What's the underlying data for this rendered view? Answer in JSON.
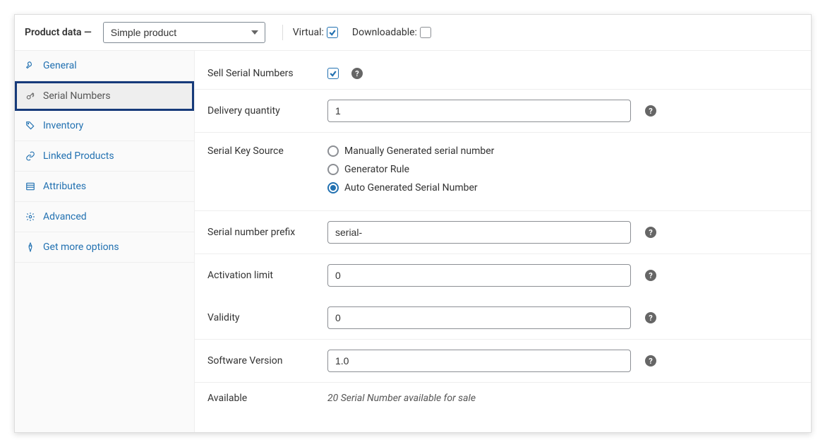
{
  "header": {
    "title": "Product data —",
    "product_type": "Simple product",
    "virtual_label": "Virtual:",
    "virtual_checked": true,
    "downloadable_label": "Downloadable:",
    "downloadable_checked": false
  },
  "sidebar": {
    "items": [
      {
        "label": "General",
        "icon": "wrench",
        "active": false
      },
      {
        "label": "Serial Numbers",
        "icon": "key",
        "active": true,
        "highlighted": true
      },
      {
        "label": "Inventory",
        "icon": "tag",
        "active": false
      },
      {
        "label": "Linked Products",
        "icon": "link",
        "active": false
      },
      {
        "label": "Attributes",
        "icon": "list",
        "active": false
      },
      {
        "label": "Advanced",
        "icon": "gear",
        "active": false
      },
      {
        "label": "Get more options",
        "icon": "pin",
        "active": false
      }
    ]
  },
  "form": {
    "sell_serial_label": "Sell Serial Numbers",
    "sell_serial_checked": true,
    "delivery_qty_label": "Delivery quantity",
    "delivery_qty_value": "1",
    "serial_key_source_label": "Serial Key Source",
    "serial_key_source_options": [
      {
        "label": "Manually Generated serial number",
        "selected": false
      },
      {
        "label": "Generator Rule",
        "selected": false
      },
      {
        "label": "Auto Generated Serial Number",
        "selected": true
      }
    ],
    "prefix_label": "Serial number prefix",
    "prefix_value": "serial-",
    "activation_limit_label": "Activation limit",
    "activation_limit_value": "0",
    "validity_label": "Validity",
    "validity_value": "0",
    "software_version_label": "Software Version",
    "software_version_value": "1.0",
    "available_label": "Available",
    "available_text": "20 Serial Number available for sale"
  }
}
